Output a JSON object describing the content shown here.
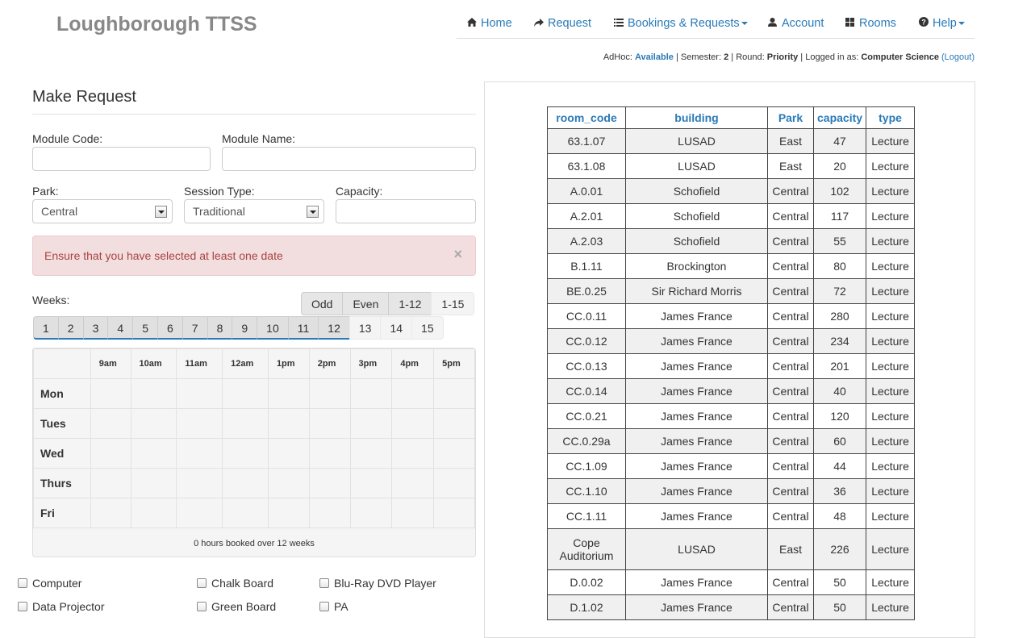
{
  "app": {
    "title": "Loughborough TTSS"
  },
  "nav": [
    {
      "label": "Home",
      "icon": "home-icon"
    },
    {
      "label": "Request",
      "icon": "share-arrow-icon"
    },
    {
      "label": "Bookings & Requests",
      "icon": "list-icon",
      "dropdown": true
    },
    {
      "label": "Account",
      "icon": "user-icon"
    },
    {
      "label": "Rooms",
      "icon": "grid-icon"
    },
    {
      "label": "Help",
      "icon": "question-circle-icon",
      "dropdown": true
    }
  ],
  "status": {
    "adhoc_label": "AdHoc:",
    "adhoc_value": "Available",
    "semester_label": "Semester:",
    "semester_value": "2",
    "round_label": "Round:",
    "round_value": "Priority",
    "logged_label": "Logged in as:",
    "logged_value": "Computer Science",
    "logout": "(Logout)"
  },
  "form": {
    "title": "Make Request",
    "module_code_label": "Module Code:",
    "module_code_value": "",
    "module_name_label": "Module Name:",
    "module_name_value": "",
    "park_label": "Park:",
    "park_value": "Central",
    "session_label": "Session Type:",
    "session_value": "Traditional",
    "capacity_label": "Capacity:",
    "capacity_value": "",
    "alert": "Ensure that you have selected at least one date",
    "alert_close": "×",
    "weeks_label": "Weeks:",
    "week_presets": [
      "Odd",
      "Even",
      "1-12",
      "1-15"
    ],
    "weeks": [
      "1",
      "2",
      "3",
      "4",
      "5",
      "6",
      "7",
      "8",
      "9",
      "10",
      "11",
      "12",
      "13",
      "14",
      "15"
    ],
    "selected_weeks": 12
  },
  "timetable": {
    "times": [
      "9am",
      "10am",
      "11am",
      "12am",
      "1pm",
      "2pm",
      "3pm",
      "4pm",
      "5pm"
    ],
    "days": [
      "Mon",
      "Tues",
      "Wed",
      "Thurs",
      "Fri"
    ],
    "footer": "0 hours booked over 12 weeks"
  },
  "facilities": [
    {
      "label": "Computer",
      "checked": false
    },
    {
      "label": "Chalk Board",
      "checked": false
    },
    {
      "label": "Blu-Ray DVD Player",
      "checked": false
    },
    {
      "label": "Data Projector",
      "checked": false
    },
    {
      "label": "Green Board",
      "checked": false
    },
    {
      "label": "PA",
      "checked": false
    }
  ],
  "rooms": {
    "headers": [
      "room_code",
      "building",
      "Park",
      "capacity",
      "type"
    ],
    "rows": [
      [
        "63.1.07",
        "LUSAD",
        "East",
        "47",
        "Lecture"
      ],
      [
        "63.1.08",
        "LUSAD",
        "East",
        "20",
        "Lecture"
      ],
      [
        "A.0.01",
        "Schofield",
        "Central",
        "102",
        "Lecture"
      ],
      [
        "A.2.01",
        "Schofield",
        "Central",
        "117",
        "Lecture"
      ],
      [
        "A.2.03",
        "Schofield",
        "Central",
        "55",
        "Lecture"
      ],
      [
        "B.1.11",
        "Brockington",
        "Central",
        "80",
        "Lecture"
      ],
      [
        "BE.0.25",
        "Sir Richard Morris",
        "Central",
        "72",
        "Lecture"
      ],
      [
        "CC.0.11",
        "James France",
        "Central",
        "280",
        "Lecture"
      ],
      [
        "CC.0.12",
        "James France",
        "Central",
        "234",
        "Lecture"
      ],
      [
        "CC.0.13",
        "James France",
        "Central",
        "201",
        "Lecture"
      ],
      [
        "CC.0.14",
        "James France",
        "Central",
        "40",
        "Lecture"
      ],
      [
        "CC.0.21",
        "James France",
        "Central",
        "120",
        "Lecture"
      ],
      [
        "CC.0.29a",
        "James France",
        "Central",
        "60",
        "Lecture"
      ],
      [
        "CC.1.09",
        "James France",
        "Central",
        "44",
        "Lecture"
      ],
      [
        "CC.1.10",
        "James France",
        "Central",
        "36",
        "Lecture"
      ],
      [
        "CC.1.11",
        "James France",
        "Central",
        "48",
        "Lecture"
      ],
      [
        "Cope Auditorium",
        "LUSAD",
        "East",
        "226",
        "Lecture"
      ],
      [
        "D.0.02",
        "James France",
        "Central",
        "50",
        "Lecture"
      ],
      [
        "D.1.02",
        "James France",
        "Central",
        "50",
        "Lecture"
      ]
    ]
  }
}
